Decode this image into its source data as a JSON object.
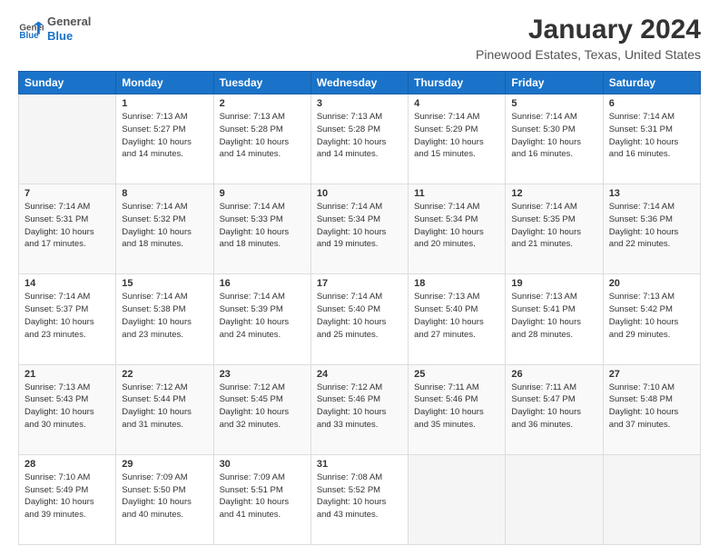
{
  "logo": {
    "general": "General",
    "blue": "Blue"
  },
  "header": {
    "title": "January 2024",
    "subtitle": "Pinewood Estates, Texas, United States"
  },
  "weekdays": [
    "Sunday",
    "Monday",
    "Tuesday",
    "Wednesday",
    "Thursday",
    "Friday",
    "Saturday"
  ],
  "weeks": [
    [
      {
        "num": "",
        "empty": true
      },
      {
        "num": "1",
        "sunrise": "7:13 AM",
        "sunset": "5:27 PM",
        "daylight": "10 hours and 14 minutes."
      },
      {
        "num": "2",
        "sunrise": "7:13 AM",
        "sunset": "5:28 PM",
        "daylight": "10 hours and 14 minutes."
      },
      {
        "num": "3",
        "sunrise": "7:13 AM",
        "sunset": "5:28 PM",
        "daylight": "10 hours and 14 minutes."
      },
      {
        "num": "4",
        "sunrise": "7:14 AM",
        "sunset": "5:29 PM",
        "daylight": "10 hours and 15 minutes."
      },
      {
        "num": "5",
        "sunrise": "7:14 AM",
        "sunset": "5:30 PM",
        "daylight": "10 hours and 16 minutes."
      },
      {
        "num": "6",
        "sunrise": "7:14 AM",
        "sunset": "5:31 PM",
        "daylight": "10 hours and 16 minutes."
      }
    ],
    [
      {
        "num": "7",
        "sunrise": "7:14 AM",
        "sunset": "5:31 PM",
        "daylight": "10 hours and 17 minutes."
      },
      {
        "num": "8",
        "sunrise": "7:14 AM",
        "sunset": "5:32 PM",
        "daylight": "10 hours and 18 minutes."
      },
      {
        "num": "9",
        "sunrise": "7:14 AM",
        "sunset": "5:33 PM",
        "daylight": "10 hours and 18 minutes."
      },
      {
        "num": "10",
        "sunrise": "7:14 AM",
        "sunset": "5:34 PM",
        "daylight": "10 hours and 19 minutes."
      },
      {
        "num": "11",
        "sunrise": "7:14 AM",
        "sunset": "5:34 PM",
        "daylight": "10 hours and 20 minutes."
      },
      {
        "num": "12",
        "sunrise": "7:14 AM",
        "sunset": "5:35 PM",
        "daylight": "10 hours and 21 minutes."
      },
      {
        "num": "13",
        "sunrise": "7:14 AM",
        "sunset": "5:36 PM",
        "daylight": "10 hours and 22 minutes."
      }
    ],
    [
      {
        "num": "14",
        "sunrise": "7:14 AM",
        "sunset": "5:37 PM",
        "daylight": "10 hours and 23 minutes."
      },
      {
        "num": "15",
        "sunrise": "7:14 AM",
        "sunset": "5:38 PM",
        "daylight": "10 hours and 23 minutes."
      },
      {
        "num": "16",
        "sunrise": "7:14 AM",
        "sunset": "5:39 PM",
        "daylight": "10 hours and 24 minutes."
      },
      {
        "num": "17",
        "sunrise": "7:14 AM",
        "sunset": "5:40 PM",
        "daylight": "10 hours and 25 minutes."
      },
      {
        "num": "18",
        "sunrise": "7:13 AM",
        "sunset": "5:40 PM",
        "daylight": "10 hours and 27 minutes."
      },
      {
        "num": "19",
        "sunrise": "7:13 AM",
        "sunset": "5:41 PM",
        "daylight": "10 hours and 28 minutes."
      },
      {
        "num": "20",
        "sunrise": "7:13 AM",
        "sunset": "5:42 PM",
        "daylight": "10 hours and 29 minutes."
      }
    ],
    [
      {
        "num": "21",
        "sunrise": "7:13 AM",
        "sunset": "5:43 PM",
        "daylight": "10 hours and 30 minutes."
      },
      {
        "num": "22",
        "sunrise": "7:12 AM",
        "sunset": "5:44 PM",
        "daylight": "10 hours and 31 minutes."
      },
      {
        "num": "23",
        "sunrise": "7:12 AM",
        "sunset": "5:45 PM",
        "daylight": "10 hours and 32 minutes."
      },
      {
        "num": "24",
        "sunrise": "7:12 AM",
        "sunset": "5:46 PM",
        "daylight": "10 hours and 33 minutes."
      },
      {
        "num": "25",
        "sunrise": "7:11 AM",
        "sunset": "5:46 PM",
        "daylight": "10 hours and 35 minutes."
      },
      {
        "num": "26",
        "sunrise": "7:11 AM",
        "sunset": "5:47 PM",
        "daylight": "10 hours and 36 minutes."
      },
      {
        "num": "27",
        "sunrise": "7:10 AM",
        "sunset": "5:48 PM",
        "daylight": "10 hours and 37 minutes."
      }
    ],
    [
      {
        "num": "28",
        "sunrise": "7:10 AM",
        "sunset": "5:49 PM",
        "daylight": "10 hours and 39 minutes."
      },
      {
        "num": "29",
        "sunrise": "7:09 AM",
        "sunset": "5:50 PM",
        "daylight": "10 hours and 40 minutes."
      },
      {
        "num": "30",
        "sunrise": "7:09 AM",
        "sunset": "5:51 PM",
        "daylight": "10 hours and 41 minutes."
      },
      {
        "num": "31",
        "sunrise": "7:08 AM",
        "sunset": "5:52 PM",
        "daylight": "10 hours and 43 minutes."
      },
      {
        "num": "",
        "empty": true
      },
      {
        "num": "",
        "empty": true
      },
      {
        "num": "",
        "empty": true
      }
    ]
  ]
}
